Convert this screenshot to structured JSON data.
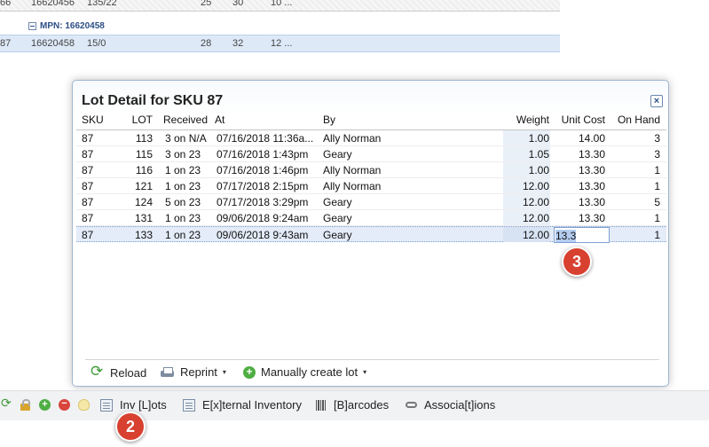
{
  "background": {
    "top_row": {
      "c1": "66",
      "c2": "16620456",
      "c3": "135/22",
      "c4": "25",
      "c5": "30",
      "c6": "10 ..."
    },
    "mpn_label": "MPN: 16620458",
    "selected_row": {
      "c1": "87",
      "c2": "16620458",
      "c3": "15/0",
      "c4": "28",
      "c5": "32",
      "c6": "12 ..."
    }
  },
  "modal": {
    "title": "Lot Detail for SKU 87",
    "close_glyph": "×",
    "columns": {
      "sku": "SKU",
      "lot": "LOT",
      "received": "Received",
      "at": "At",
      "by": "By",
      "weight": "Weight",
      "unit_cost": "Unit Cost",
      "on_hand": "On Hand"
    },
    "rows": [
      {
        "sku": "87",
        "lot": "113",
        "received": "3 on N/A",
        "at": "07/16/2018 11:36a...",
        "by": "Ally Norman",
        "weight": "1.00",
        "unit_cost": "14.00",
        "on_hand": "3"
      },
      {
        "sku": "87",
        "lot": "115",
        "received": "3 on 23",
        "at": "07/16/2018 1:43pm",
        "by": "Geary",
        "weight": "1.05",
        "unit_cost": "13.30",
        "on_hand": "3"
      },
      {
        "sku": "87",
        "lot": "116",
        "received": "1 on 23",
        "at": "07/16/2018 1:46pm",
        "by": "Ally Norman",
        "weight": "1.00",
        "unit_cost": "13.30",
        "on_hand": "1"
      },
      {
        "sku": "87",
        "lot": "121",
        "received": "1 on 23",
        "at": "07/17/2018 2:15pm",
        "by": "Ally Norman",
        "weight": "12.00",
        "unit_cost": "13.30",
        "on_hand": "1"
      },
      {
        "sku": "87",
        "lot": "124",
        "received": "5 on 23",
        "at": "07/17/2018 3:29pm",
        "by": "Geary",
        "weight": "12.00",
        "unit_cost": "13.30",
        "on_hand": "5"
      },
      {
        "sku": "87",
        "lot": "131",
        "received": "1 on 23",
        "at": "09/06/2018 9:24am",
        "by": "Geary",
        "weight": "12.00",
        "unit_cost": "13.30",
        "on_hand": "1"
      },
      {
        "sku": "87",
        "lot": "133",
        "received": "1 on 23",
        "at": "09/06/2018 9:43am",
        "by": "Geary",
        "weight": "12.00",
        "unit_cost": "",
        "on_hand": "1"
      }
    ],
    "edit_cell_value": "13.3",
    "toolbar": {
      "reload": "Reload",
      "reprint": "Reprint",
      "create_lot": "Manually create lot",
      "caret": "▾"
    }
  },
  "bottom_tabs": {
    "inv_lots": "Inv [L]ots",
    "external_inventory": "E[x]ternal Inventory",
    "barcodes": "[B]arcodes",
    "associations": "Associa[t]ions",
    "add_glyph": "+",
    "remove_glyph": "−",
    "refresh_glyph": "⟳"
  },
  "callouts": {
    "one": "2",
    "two": "3"
  },
  "colors": {
    "badge": "#d8402f",
    "accent": "#2d4f86",
    "selection": "#dde9f7"
  }
}
